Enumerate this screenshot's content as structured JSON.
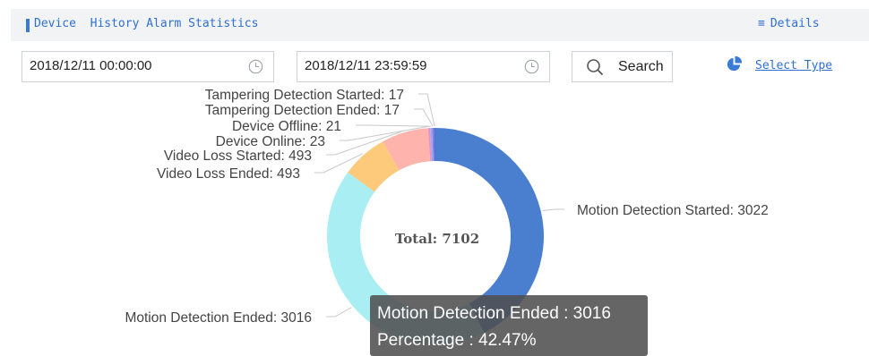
{
  "header": {
    "title": "Device  History Alarm Statistics",
    "details_label": "Details",
    "details_icon": "list-icon"
  },
  "filters": {
    "start_time": "2018/12/11 00:00:00",
    "end_time": "2018/12/11 23:59:59",
    "search_label": "Search",
    "select_type_label": "Select Type"
  },
  "chart_data": {
    "type": "pie",
    "variant": "donut",
    "center_label": "Total: 7102",
    "total": 7102,
    "slices": [
      {
        "name": "Motion Detection Started",
        "value": 3022,
        "color": "#4a7fd0",
        "label": "Motion Detection Started: 3022"
      },
      {
        "name": "Motion Detection Ended",
        "value": 3016,
        "color": "#a8eef2",
        "label": "Motion Detection Ended: 3016"
      },
      {
        "name": "Video Loss Ended",
        "value": 493,
        "color": "#fdc97a",
        "label": "Video Loss Ended: 493"
      },
      {
        "name": "Video Loss Started",
        "value": 493,
        "color": "#ffb3ad",
        "label": "Video Loss Started: 493"
      },
      {
        "name": "Device Online",
        "value": 23,
        "color": "#e993c2",
        "label": "Device Online: 23"
      },
      {
        "name": "Device Offline",
        "value": 21,
        "color": "#9aa7f0",
        "label": "Device Offline: 21"
      },
      {
        "name": "Tampering Detection Ended",
        "value": 17,
        "color": "#7b89e4",
        "label": "Tampering Detection Ended: 17"
      },
      {
        "name": "Tampering Detection Started",
        "value": 17,
        "color": "#5b6ad8",
        "label": "Tampering Detection Started: 17"
      }
    ],
    "tooltip": {
      "title": "Motion Detection Ended : 3016",
      "percentage": "Percentage : 42.47%"
    }
  }
}
